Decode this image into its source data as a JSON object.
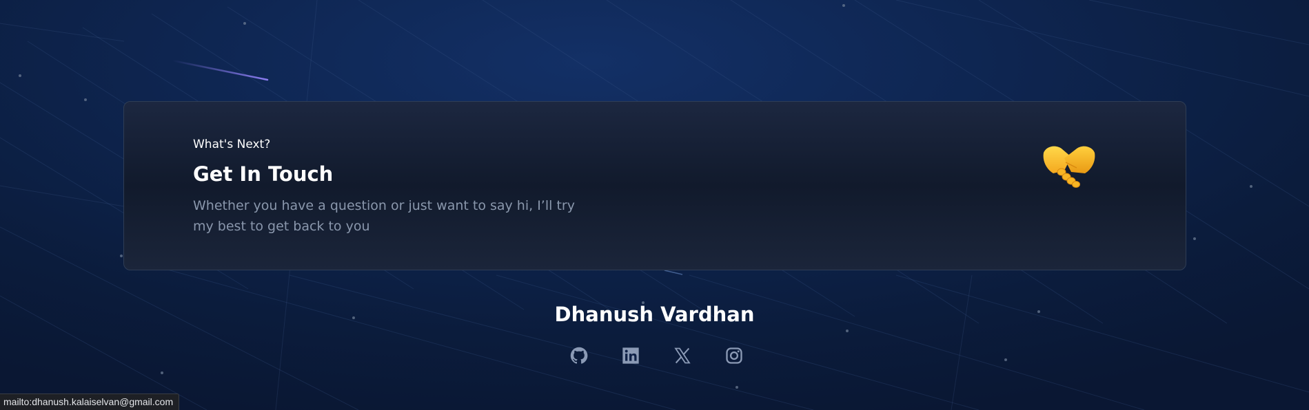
{
  "contact_card": {
    "eyebrow": "What's Next?",
    "title": "Get In Touch",
    "description": "Whether you have a question or just want to say hi, I’ll try my best to get back to you",
    "emoji_icon": "handshake-icon"
  },
  "footer": {
    "name": "Dhanush Vardhan",
    "social_links": [
      {
        "name": "github",
        "icon": "github-icon"
      },
      {
        "name": "linkedin",
        "icon": "linkedin-icon"
      },
      {
        "name": "x",
        "icon": "x-icon"
      },
      {
        "name": "instagram",
        "icon": "instagram-icon"
      }
    ]
  },
  "status_bar": {
    "link_preview": "mailto:dhanush.kalaiselvan@gmail.com"
  },
  "colors": {
    "background": "#0e2550",
    "card_background": "#131c2f",
    "text_primary": "#ffffff",
    "text_muted": "#8a97ac",
    "icon": "#8b9ab5",
    "shooting_star": "#8b7cf0"
  }
}
